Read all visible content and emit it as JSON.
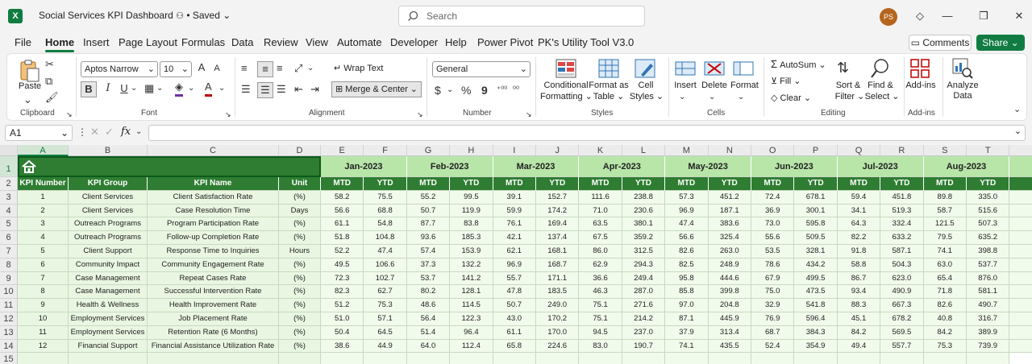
{
  "titlebar": {
    "doc_title": "Social Services KPI Dashboard",
    "saved": "• Saved",
    "search_placeholder": "Search",
    "avatar": "PS",
    "logo_letter": "X"
  },
  "menu": {
    "tabs": [
      "File",
      "Home",
      "Insert",
      "Page Layout",
      "Formulas",
      "Data",
      "Review",
      "View",
      "Automate",
      "Developer",
      "Help",
      "Power Pivot",
      "PK's Utility Tool V3.0"
    ],
    "comments": "Comments",
    "share": "Share"
  },
  "ribbon": {
    "clipboard": {
      "paste": "Paste",
      "label": "Clipboard"
    },
    "font": {
      "name": "Aptos Narrow",
      "size": "10",
      "bold": "B",
      "italic": "I",
      "underline": "U",
      "label": "Font",
      "grow": "A",
      "shrink": "A"
    },
    "alignment": {
      "wrap": "Wrap Text",
      "merge": "Merge & Center",
      "label": "Alignment"
    },
    "number": {
      "format": "General",
      "currency": "$",
      "percent": "%",
      "comma": "9",
      "label": "Number"
    },
    "styles": {
      "conditional": "Conditional",
      "conditional2": "Formatting",
      "format_table": "Format as",
      "format_table2": "Table",
      "cell_styles": "Cell",
      "cell_styles2": "Styles",
      "label": "Styles"
    },
    "cells": {
      "insert": "Insert",
      "delete": "Delete",
      "format": "Format",
      "label": "Cells"
    },
    "editing": {
      "autosum": "AutoSum",
      "fill": "Fill",
      "clear": "Clear",
      "sort": "Sort &",
      "sort2": "Filter",
      "find": "Find &",
      "find2": "Select",
      "label": "Editing"
    },
    "addins": {
      "addins": "Add-ins",
      "label": "Add-ins"
    },
    "analyze": {
      "line1": "Analyze",
      "line2": "Data"
    }
  },
  "formula": {
    "namebox": "A1",
    "fx": "fx"
  },
  "sheet": {
    "columns": [
      "A",
      "B",
      "C",
      "D",
      "E",
      "F",
      "G",
      "H",
      "I",
      "J",
      "K",
      "L",
      "M",
      "N",
      "O",
      "P",
      "Q",
      "R",
      "S",
      "T"
    ],
    "months": [
      "Jan-2023",
      "Feb-2023",
      "Mar-2023",
      "Apr-2023",
      "May-2023",
      "Jun-2023",
      "Jul-2023",
      "Aug-2023"
    ],
    "headers": [
      "KPI Number",
      "KPI Group",
      "KPI Name",
      "Unit"
    ],
    "mtd": "MTD",
    "ytd": "YTD",
    "rows": [
      [
        "1",
        "Client Services",
        "Client Satisfaction Rate",
        "(%)",
        "58.2",
        "75.5",
        "55.2",
        "99.5",
        "39.1",
        "152.7",
        "111.6",
        "238.8",
        "57.3",
        "451.2",
        "72.4",
        "678.1",
        "59.4",
        "451.8",
        "89.8",
        "335.0"
      ],
      [
        "2",
        "Client Services",
        "Case Resolution Time",
        "Days",
        "56.6",
        "68.8",
        "50.7",
        "119.9",
        "59.9",
        "174.2",
        "71.0",
        "230.6",
        "96.9",
        "187.1",
        "36.9",
        "300.1",
        "34.1",
        "519.3",
        "58.7",
        "515.6"
      ],
      [
        "3",
        "Outreach Programs",
        "Program Participation Rate",
        "(%)",
        "61.1",
        "54.8",
        "87.7",
        "83.8",
        "76.1",
        "169.4",
        "63.5",
        "380.1",
        "47.4",
        "383.6",
        "73.0",
        "595.8",
        "64.3",
        "332.4",
        "121.5",
        "507.3"
      ],
      [
        "4",
        "Outreach Programs",
        "Follow-up Completion Rate",
        "(%)",
        "51.8",
        "104.8",
        "93.6",
        "185.3",
        "42.1",
        "137.4",
        "67.5",
        "359.2",
        "56.6",
        "325.4",
        "55.6",
        "509.5",
        "82.2",
        "633.2",
        "79.5",
        "635.2"
      ],
      [
        "5",
        "Client Support",
        "Response Time to Inquiries",
        "Hours",
        "52.2",
        "47.4",
        "57.4",
        "153.9",
        "62.1",
        "168.1",
        "86.0",
        "312.5",
        "82.6",
        "263.0",
        "53.5",
        "328.1",
        "91.8",
        "587.1",
        "74.1",
        "398.8"
      ],
      [
        "6",
        "Community Impact",
        "Community Engagement Rate",
        "(%)",
        "49.5",
        "106.6",
        "37.3",
        "132.2",
        "96.9",
        "168.7",
        "62.9",
        "294.3",
        "82.5",
        "248.9",
        "78.6",
        "434.2",
        "58.8",
        "504.3",
        "63.0",
        "537.7"
      ],
      [
        "7",
        "Case Management",
        "Repeat Cases Rate",
        "(%)",
        "72.3",
        "102.7",
        "53.7",
        "141.2",
        "55.7",
        "171.1",
        "36.6",
        "249.4",
        "95.8",
        "444.6",
        "67.9",
        "499.5",
        "86.7",
        "623.0",
        "65.4",
        "876.0"
      ],
      [
        "8",
        "Case Management",
        "Successful Intervention Rate",
        "(%)",
        "82.3",
        "62.7",
        "80.2",
        "128.1",
        "47.8",
        "183.5",
        "46.3",
        "287.0",
        "85.8",
        "399.8",
        "75.0",
        "473.5",
        "93.4",
        "490.9",
        "71.8",
        "581.1"
      ],
      [
        "9",
        "Health & Wellness",
        "Health Improvement Rate",
        "(%)",
        "51.2",
        "75.3",
        "48.6",
        "114.5",
        "50.7",
        "249.0",
        "75.1",
        "271.6",
        "97.0",
        "204.8",
        "32.9",
        "541.8",
        "88.3",
        "667.3",
        "82.6",
        "490.7"
      ],
      [
        "10",
        "Employment Services",
        "Job Placement Rate",
        "(%)",
        "51.0",
        "57.1",
        "56.4",
        "122.3",
        "43.0",
        "170.2",
        "75.1",
        "214.2",
        "87.1",
        "445.9",
        "76.9",
        "596.4",
        "45.1",
        "678.2",
        "40.8",
        "316.7"
      ],
      [
        "11",
        "Employment Services",
        "Retention Rate (6 Months)",
        "(%)",
        "50.4",
        "64.5",
        "51.4",
        "96.4",
        "61.1",
        "170.0",
        "94.5",
        "237.0",
        "37.9",
        "313.4",
        "68.7",
        "384.3",
        "84.2",
        "569.5",
        "84.2",
        "389.9"
      ],
      [
        "12",
        "Financial Support",
        "Financial Assistance Utilization Rate",
        "(%)",
        "38.6",
        "44.9",
        "64.0",
        "112.4",
        "65.8",
        "224.6",
        "83.0",
        "190.7",
        "74.1",
        "435.5",
        "52.4",
        "354.9",
        "49.4",
        "557.7",
        "75.3",
        "739.9"
      ]
    ],
    "row_numbers": [
      "1",
      "2",
      "3",
      "4",
      "5",
      "6",
      "7",
      "8",
      "9",
      "10",
      "11",
      "12",
      "13",
      "14",
      "15"
    ]
  }
}
